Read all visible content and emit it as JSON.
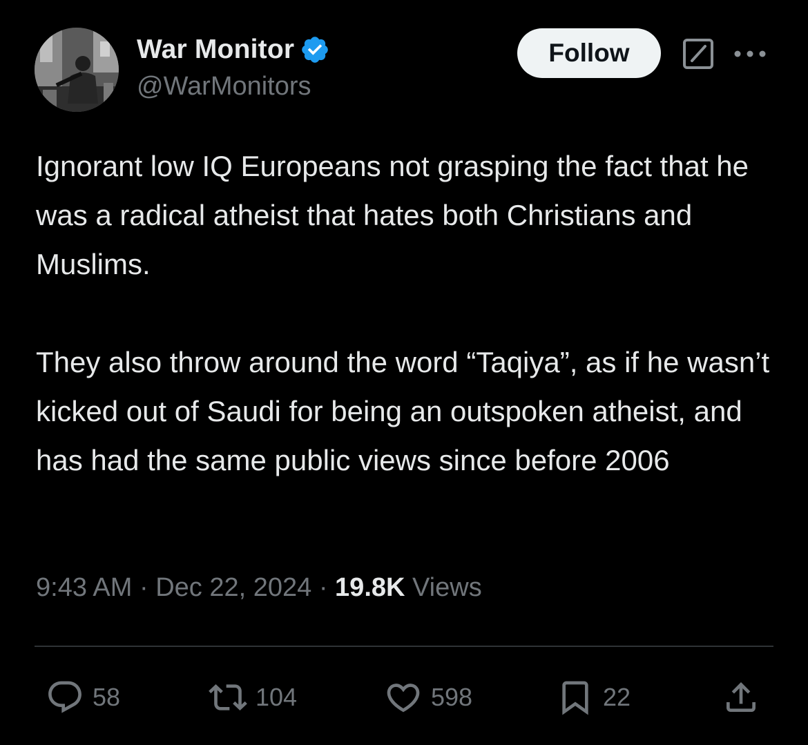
{
  "author": {
    "display_name": "War Monitor",
    "handle": "@WarMonitors",
    "verified": true
  },
  "header": {
    "follow_label": "Follow",
    "icons": [
      "grok-icon",
      "more-icon"
    ]
  },
  "tweet": {
    "paragraphs": [
      "Ignorant low IQ Europeans not grasping the fact that he was a radical atheist that hates both Christians and Muslims.",
      "They also throw around the word “Taqiya”, as if he wasn’t kicked out of Saudi for being an outspoken atheist, and has had the same public views since before 2006"
    ]
  },
  "meta": {
    "time": "9:43 AM",
    "separator": " · ",
    "date": "Dec 22, 2024",
    "views_count": "19.8K",
    "views_label": " Views"
  },
  "actions": {
    "reply_count": "58",
    "repost_count": "104",
    "like_count": "598",
    "bookmark_count": "22"
  },
  "colors": {
    "background": "#000000",
    "text": "#e7e9ea",
    "muted": "#71767b",
    "verified": "#1d9bf0",
    "divider": "#2f3336",
    "follow_bg": "#eff3f4"
  }
}
